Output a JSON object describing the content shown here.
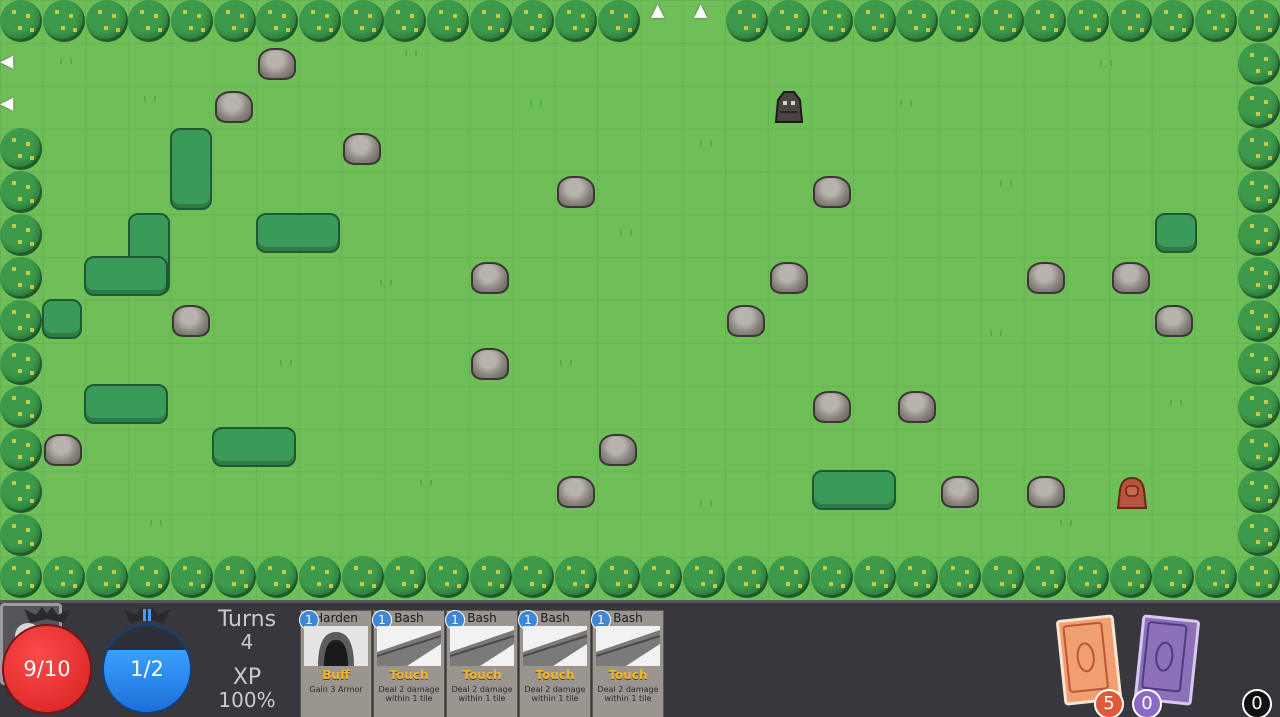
{
  "hud": {
    "hp": "9/10",
    "mana": "1/2",
    "turns_label": "Turns",
    "turns_value": "4",
    "xp_label": "XP",
    "xp_value": "100%"
  },
  "hand": [
    {
      "cost": "1",
      "name": "Harden",
      "type": "Buff",
      "desc": "Gain 3 Armor",
      "art": "cave-icon"
    },
    {
      "cost": "1",
      "name": "Bash",
      "type": "Touch",
      "desc": "Deal 2 damage within 1 tile",
      "art": "rock-slide-icon"
    },
    {
      "cost": "1",
      "name": "Bash",
      "type": "Touch",
      "desc": "Deal 2 damage within 1 tile",
      "art": "rock-slide-icon"
    },
    {
      "cost": "1",
      "name": "Bash",
      "type": "Touch",
      "desc": "Deal 2 damage within 1 tile",
      "art": "rock-slide-icon"
    },
    {
      "cost": "1",
      "name": "Bash",
      "type": "Touch",
      "desc": "Deal 2 damage within 1 tile",
      "art": "rock-slide-icon"
    }
  ],
  "piles": {
    "draw_count": "5",
    "discard_count": "0",
    "exhaust_count": "0"
  },
  "colors": {
    "grass": "#6fbf58",
    "hp": "#e02a2a",
    "mana": "#2f8ff0",
    "card_type": "#f0b630"
  }
}
